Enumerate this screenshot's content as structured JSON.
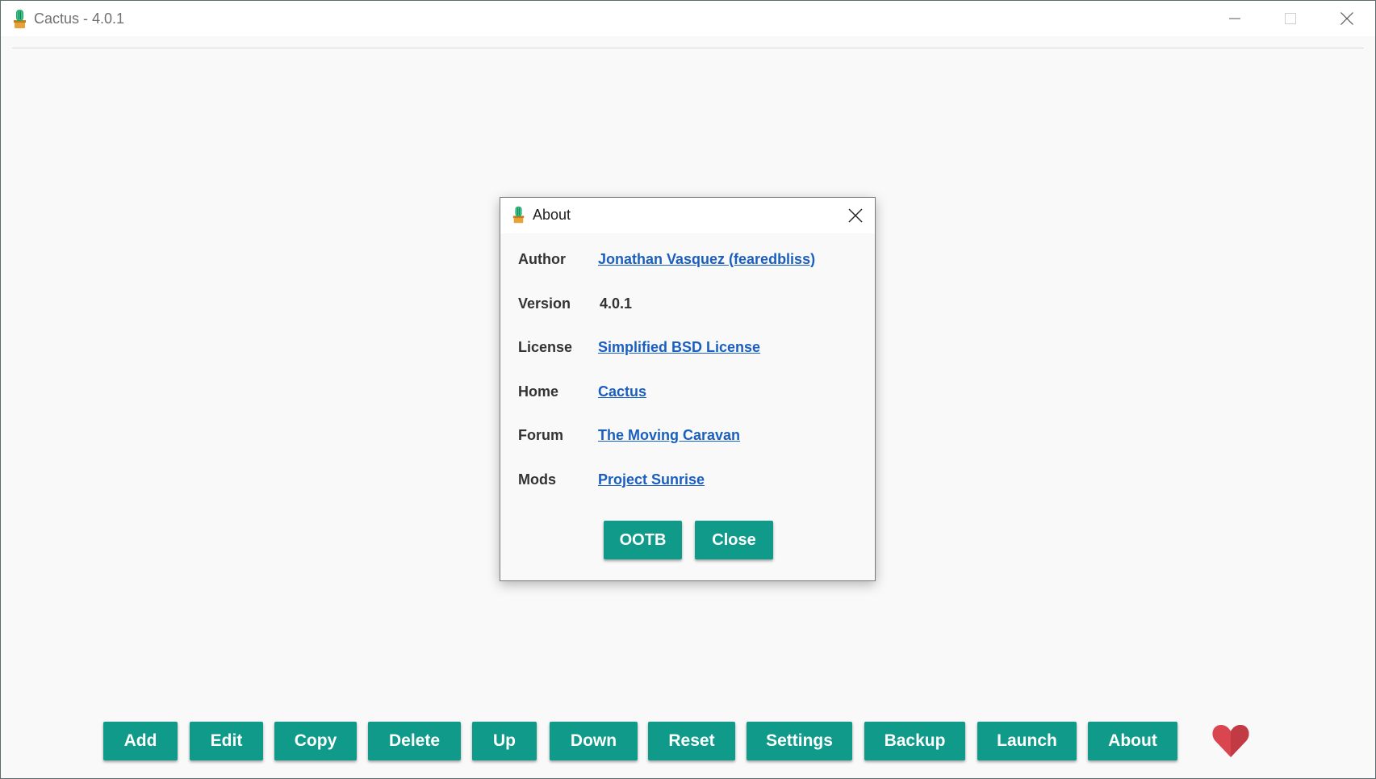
{
  "window": {
    "title": "Cactus - 4.0.1",
    "icon": "cactus-icon"
  },
  "dialog": {
    "title": "About",
    "icon": "cactus-icon",
    "rows": [
      {
        "label": "Author",
        "value": "Jonathan Vasquez (fearedbliss)",
        "is_link": true
      },
      {
        "label": "Version",
        "value": "4.0.1",
        "is_link": false
      },
      {
        "label": "License",
        "value": "Simplified BSD License",
        "is_link": true
      },
      {
        "label": "Home",
        "value": "Cactus",
        "is_link": true
      },
      {
        "label": "Forum",
        "value": "The Moving Caravan",
        "is_link": true
      },
      {
        "label": "Mods",
        "value": "Project Sunrise",
        "is_link": true
      }
    ],
    "buttons": {
      "ootb": "OOTB",
      "close": "Close"
    }
  },
  "toolbar": {
    "add": "Add",
    "edit": "Edit",
    "copy": "Copy",
    "delete": "Delete",
    "up": "Up",
    "down": "Down",
    "reset": "Reset",
    "settings": "Settings",
    "backup": "Backup",
    "launch": "Launch",
    "about": "About",
    "donate_icon": "heart-icon"
  },
  "colors": {
    "accent": "#0f9a8a",
    "link": "#1a5fbf",
    "heart": "#d9464f"
  }
}
